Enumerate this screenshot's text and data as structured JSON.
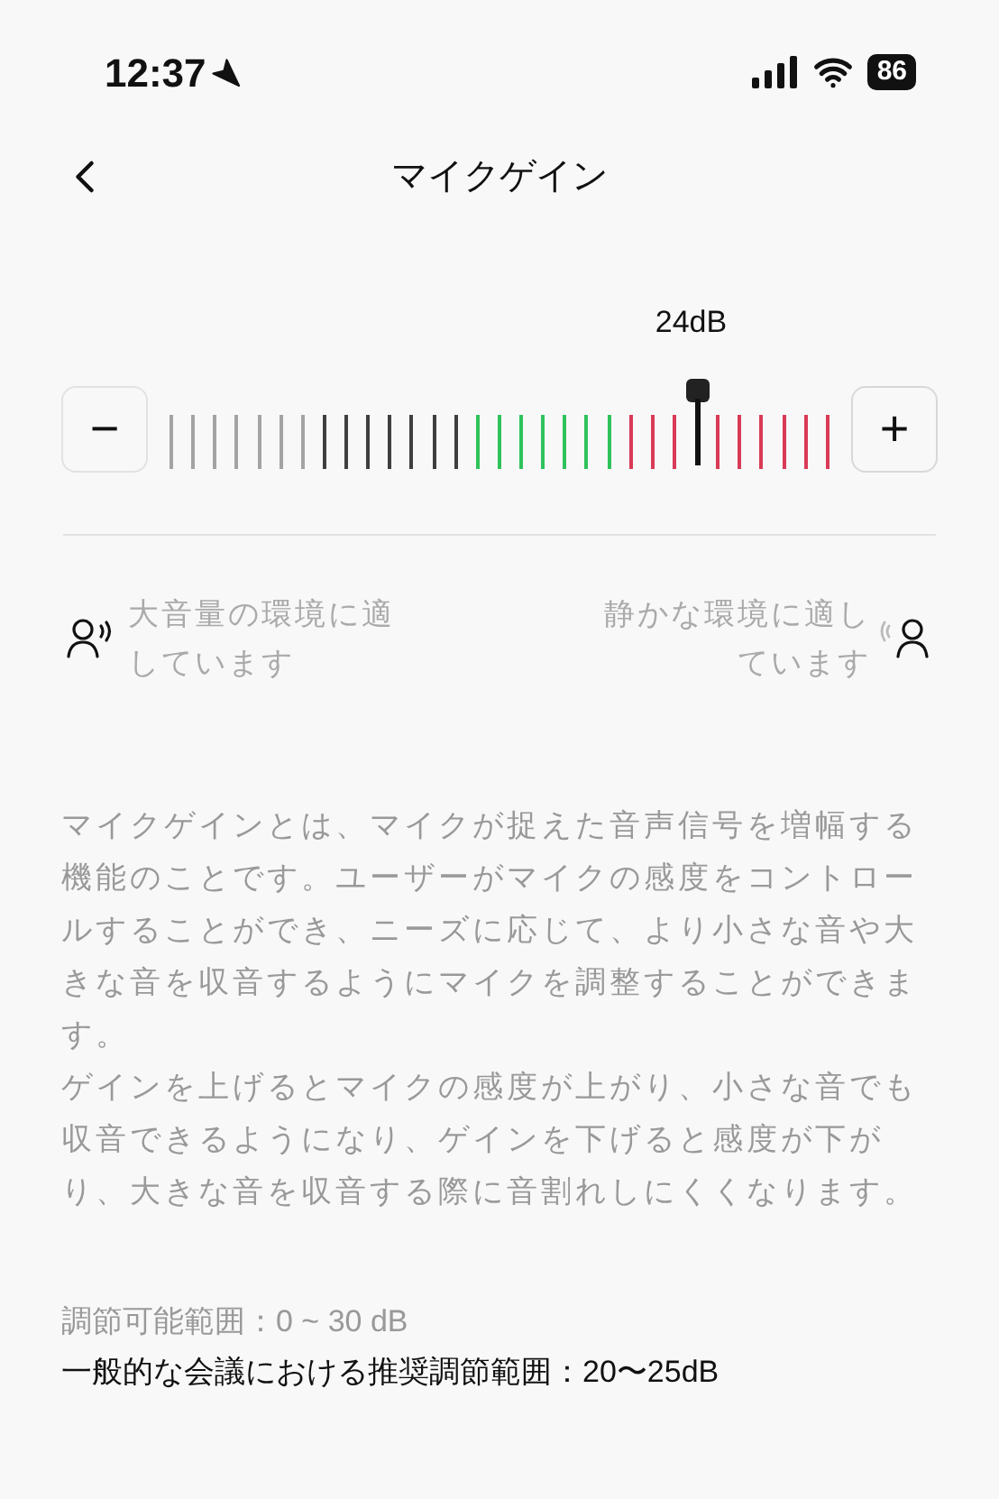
{
  "status_bar": {
    "time": "12:37",
    "battery": "86"
  },
  "nav": {
    "title": "マイクゲイン"
  },
  "gain": {
    "reading": "24dB",
    "minus": "−",
    "plus": "+"
  },
  "hints": [
    {
      "kind": "loud",
      "text": "大音量の環境に適しています"
    },
    {
      "kind": "quiet",
      "text": "静かな環境に適しています"
    }
  ],
  "description": [
    "マイクゲインとは、マイクが捉えた音声信号を増幅する機能のことです。ユーザーがマイクの感度をコントロールすることができ、ニーズに応じて、より小さな音や大きな音を収音するようにマイクを調整することができます。",
    "ゲインを上げるとマイクの感度が上がり、小さな音でも収音できるようになり、ゲインを下げると感度が下がり、大きな音を収音する際に音割れしにくくなります。"
  ],
  "ranges": [
    {
      "kind": "muted",
      "text": "調節可能範囲：0 ~ 30 dB"
    },
    {
      "kind": "strong",
      "text": "一般的な会議における推奨調節範囲：20〜25dB"
    }
  ]
}
